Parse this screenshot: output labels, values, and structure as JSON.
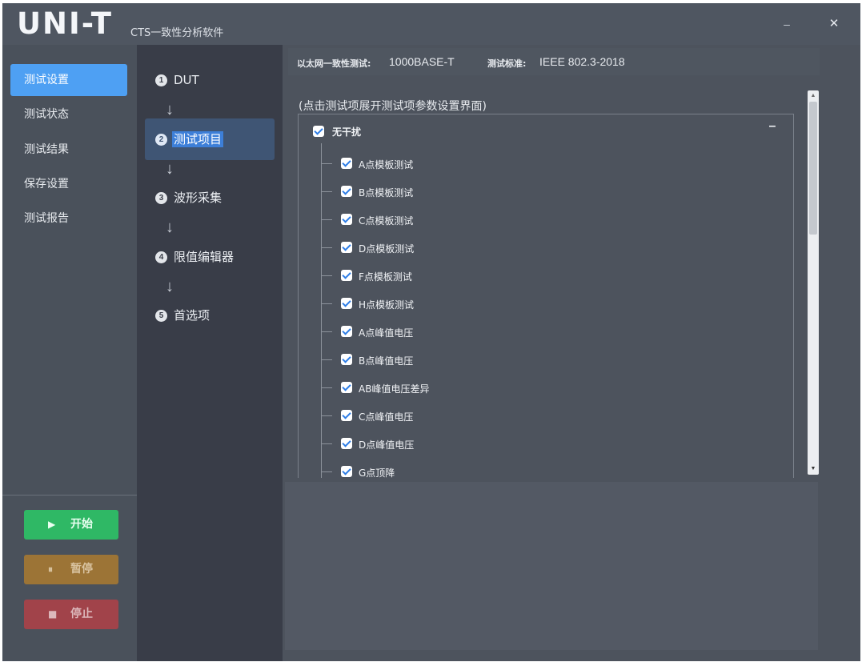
{
  "window": {
    "logo": "UNI-T",
    "title": "CTS一致性分析软件",
    "minimize_glyph": "–",
    "close_glyph": "✕"
  },
  "nav": {
    "items": [
      {
        "label": "测试设置",
        "active": true
      },
      {
        "label": "测试状态",
        "active": false
      },
      {
        "label": "测试结果",
        "active": false
      },
      {
        "label": "保存设置",
        "active": false
      },
      {
        "label": "测试报告",
        "active": false
      }
    ],
    "controls": {
      "start": {
        "icon": "play-icon",
        "glyph": "▶",
        "label": "开始"
      },
      "pause": {
        "icon": "pause-icon",
        "glyph": "⏸",
        "label": "暂停"
      },
      "stop": {
        "icon": "stop-icon",
        "glyph": "■",
        "label": "停止"
      }
    }
  },
  "steps": [
    {
      "num": "1",
      "label": "DUT",
      "active": false
    },
    {
      "num": "2",
      "label": "测试项目",
      "active": true
    },
    {
      "num": "3",
      "label": "波形采集",
      "active": false
    },
    {
      "num": "4",
      "label": "限值编辑器",
      "active": false
    },
    {
      "num": "5",
      "label": "首选项",
      "active": false
    }
  ],
  "step_arrow": "↓",
  "info": {
    "test_label": "以太网一致性测试:",
    "test_value": "1000BASE-T",
    "standard_label": "测试标准:",
    "standard_value": "IEEE 802.3-2018"
  },
  "panel": {
    "hint": "(点击测试项展开测试项参数设置界面)",
    "root": {
      "label": "无干扰",
      "checked": true,
      "collapse_glyph": "–"
    },
    "items": [
      {
        "label": "A点模板测试",
        "checked": true
      },
      {
        "label": "B点模板测试",
        "checked": true
      },
      {
        "label": "C点模板测试",
        "checked": true
      },
      {
        "label": "D点模板测试",
        "checked": true
      },
      {
        "label": "F点模板测试",
        "checked": true
      },
      {
        "label": "H点模板测试",
        "checked": true
      },
      {
        "label": "A点峰值电压",
        "checked": true
      },
      {
        "label": "B点峰值电压",
        "checked": true
      },
      {
        "label": "AB峰值电压差异",
        "checked": true
      },
      {
        "label": "C点峰值电压",
        "checked": true
      },
      {
        "label": "D点峰值电压",
        "checked": true
      },
      {
        "label": "G点顶降",
        "checked": true
      }
    ]
  },
  "scrollbar": {
    "up_glyph": "▲",
    "down_glyph": "▼",
    "position_fraction": 0.0
  },
  "colors": {
    "accent": "#4ea0f3",
    "start": "#2fb865",
    "pause": "#9c7436",
    "stop": "#a1434a",
    "checkbox_check": "#2f7ee6"
  }
}
